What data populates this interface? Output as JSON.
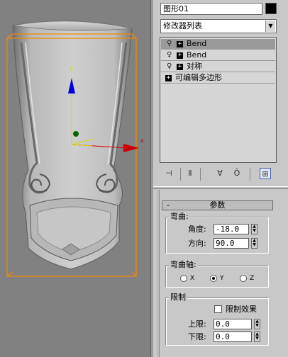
{
  "object": {
    "name": "图形01",
    "color": "#000000"
  },
  "modifier_list": {
    "label": "修改器列表"
  },
  "stack": [
    {
      "label": "Bend",
      "selected": true
    },
    {
      "label": "Bend",
      "selected": false
    },
    {
      "label": "对称",
      "selected": false
    },
    {
      "label": "可编辑多边形",
      "selected": false
    }
  ],
  "viewport": {
    "gizmo_color": "#f28a00",
    "axis_colors": {
      "x": "#d00000",
      "y": "#d8d800",
      "z": "#0000e0"
    },
    "axis_x_label": "x",
    "axis_y_label": "y"
  },
  "parameters": {
    "rollout_title": "参数",
    "bend": {
      "title": "弯曲:",
      "angle_label": "角度:",
      "angle_value": "-18.0",
      "direction_label": "方向:",
      "direction_value": "90.0"
    },
    "bend_axis": {
      "title": "弯曲轴:",
      "options": [
        "X",
        "Y",
        "Z"
      ],
      "selected": "Y"
    },
    "limits": {
      "title": "限制",
      "limit_effect_label": "限制效果",
      "limit_effect_checked": false,
      "upper_label": "上限:",
      "upper_value": "0.0",
      "lower_label": "下限:",
      "lower_value": "0.0"
    }
  }
}
